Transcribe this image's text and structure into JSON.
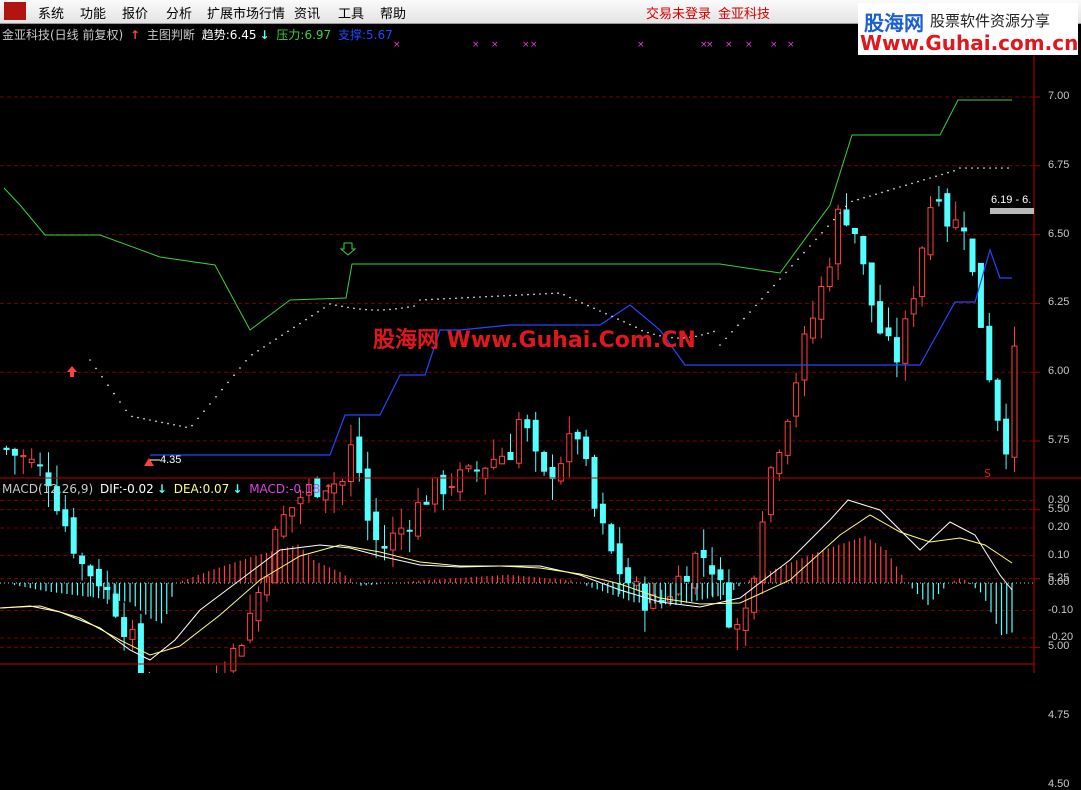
{
  "menubar": {
    "items": [
      "系统",
      "功能",
      "报价",
      "分析",
      "扩展市场行情",
      "资讯",
      "工具",
      "帮助"
    ],
    "status": [
      "交易未登录",
      "金亚科技"
    ]
  },
  "watermark": {
    "site_cn": "股海网",
    "slogan": "股票软件资源分享",
    "url": "Www.Guhai.com.cn",
    "center": "股海网 Www.Guhai.Com.CN"
  },
  "main_header": {
    "title": "金亚科技(日线 前复权)",
    "indicator": "主图判断",
    "trend_label": "趋势:",
    "trend_value": "6.45",
    "pressure_label": "压力:",
    "pressure_value": "6.97",
    "support_label": "支撑:",
    "support_value": "5.67"
  },
  "macd_header": {
    "name": "MACD(12,26,9)",
    "dif_label": "DIF:",
    "dif_value": "-0.02",
    "dea_label": "DEA:",
    "dea_value": "0.07",
    "macd_label": "MACD:",
    "macd_value": "-0.18"
  },
  "price_ticks": [
    "7.00",
    "6.75",
    "6.50",
    "6.25",
    "6.00",
    "5.75",
    "5.50",
    "5.25",
    "5.00",
    "4.75",
    "4.50"
  ],
  "macd_ticks": [
    "0.30",
    "0.20",
    "0.10",
    "0.00",
    "-0.10",
    "-0.20"
  ],
  "annotations": {
    "low_label": "4.35",
    "last_label": "6.19 - 6.",
    "signal": "S"
  },
  "colors": {
    "up": "#ff4040",
    "down": "#54ffff",
    "pressure": "#3ad23a",
    "support": "#2446ff",
    "trend_dots": "#ffffff",
    "grid": "#7a0000",
    "macd_pos": "#ff4040",
    "macd_neg": "#54ffff",
    "dif": "#ffffff",
    "dea": "#ffff80"
  },
  "icons": [
    "app-logo-icon",
    "up-arrow-icon",
    "down-arrow-icon"
  ]
}
